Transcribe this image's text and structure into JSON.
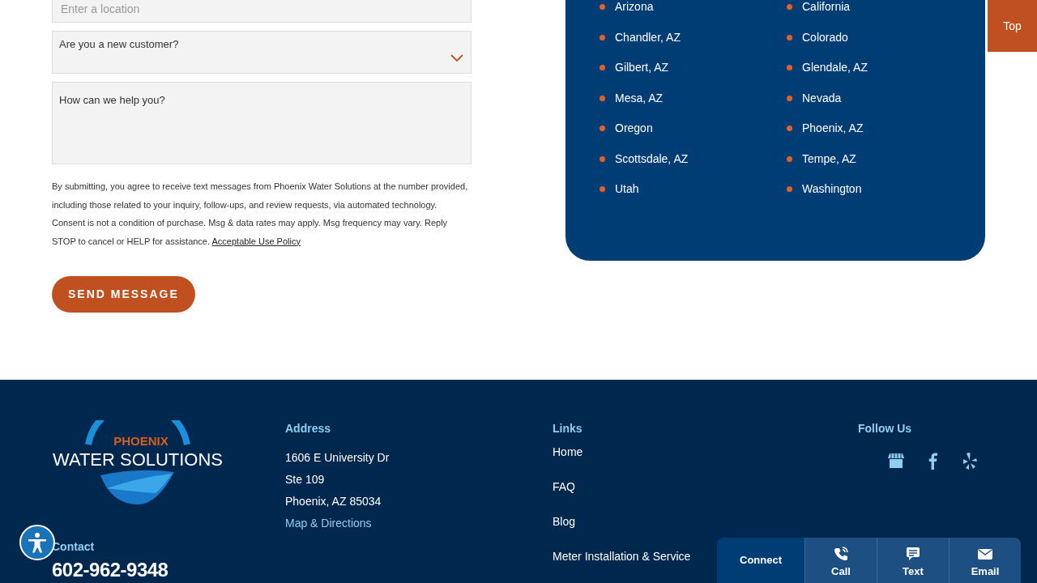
{
  "location_field": {
    "placeholder": "Enter a location"
  },
  "customer_select": {
    "label": "Are you a new customer?"
  },
  "message_field": {
    "placeholder": "How can we help you?"
  },
  "consent": {
    "text": "By submitting, you agree to receive text messages from Phoenix Water Solutions at the number provided, including those related to your inquiry, follow-ups, and review requests, via automated technology. Consent is not a condition of purchase. Msg & data rates may apply. Msg frequency may vary. Reply STOP to cancel or HELP for assistance.",
    "link": "Acceptable Use Policy"
  },
  "send_button": "SEND MESSAGE",
  "service_areas": [
    {
      "items": [
        "Arizona",
        "Chandler, AZ",
        "Gilbert, AZ",
        "Mesa, AZ",
        "Oregon",
        "Scottsdale, AZ",
        "Utah"
      ]
    },
    {
      "items": [
        "California",
        "Colorado",
        "Glendale, AZ",
        "Nevada",
        "Phoenix, AZ",
        "Tempe, AZ",
        "Washington"
      ]
    }
  ],
  "top_button": "Top",
  "footer": {
    "logo": {
      "line_1": "PHOENIX",
      "line_2": "WATER SOLUTIONS"
    },
    "contact": {
      "heading": "Contact",
      "phone": "602-962-9348"
    },
    "address": {
      "heading": "Address",
      "lines": [
        "1606 E University Dr",
        "Ste 109",
        "Phoenix, AZ 85034"
      ],
      "link": "Map & Directions"
    },
    "links": {
      "heading": "Links",
      "items": [
        "Home",
        "FAQ",
        "Blog",
        "Meter Installation & Service"
      ]
    },
    "follow": {
      "heading": "Follow Us",
      "icons": [
        {
          "kind": "store"
        },
        {
          "kind": "facebook"
        },
        {
          "kind": "yelp"
        }
      ]
    }
  },
  "connect_bar": {
    "label": "Connect",
    "actions": [
      {
        "label": "Call",
        "kind": "call"
      },
      {
        "label": "Text",
        "kind": "text"
      },
      {
        "label": "Email",
        "kind": "email"
      }
    ]
  }
}
